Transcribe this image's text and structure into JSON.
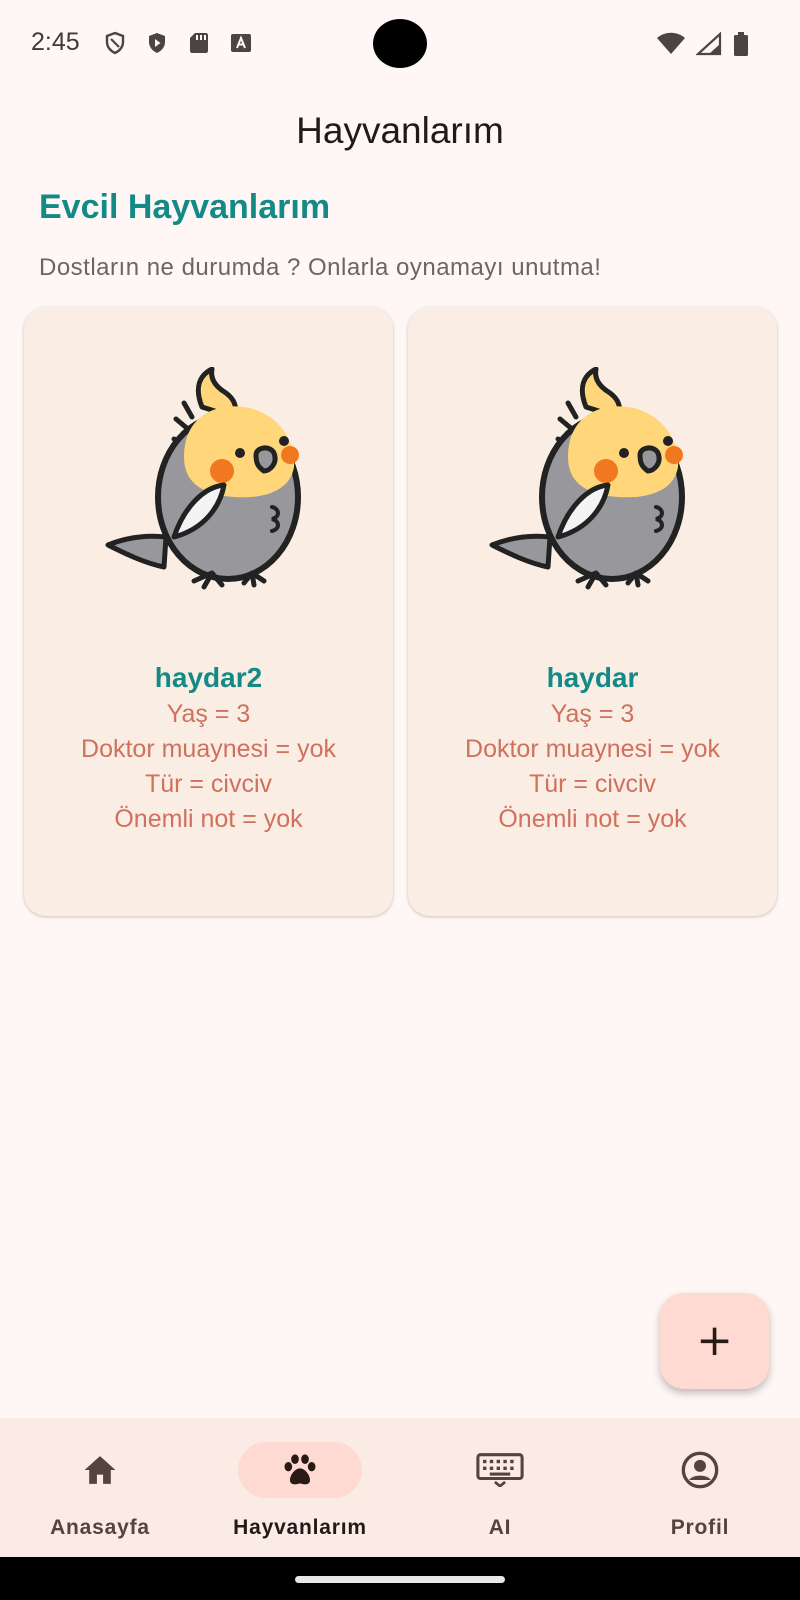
{
  "status_bar": {
    "time": "2:45",
    "icons_left": [
      "shield-outline-icon",
      "play-shield-icon",
      "sd-card-icon",
      "text-a-icon"
    ],
    "icons_right": [
      "wifi-icon",
      "cellular-signal-icon",
      "battery-icon"
    ]
  },
  "app_bar": {
    "title": "Hayvanlarım"
  },
  "section": {
    "title": "Evcil Hayvanlarım",
    "subtitle": "Dostların ne durumda ? Onlarla oynamayı unutma!"
  },
  "pets": [
    {
      "name": "haydar2",
      "age_line": "Yaş = 3",
      "doctor_line": "Doktor muaynesi = yok",
      "type_line": "Tür = civciv",
      "note_line": "Önemli not = yok",
      "image": "cockatiel-illustration"
    },
    {
      "name": "haydar",
      "age_line": "Yaş = 3",
      "doctor_line": "Doktor muaynesi = yok",
      "type_line": "Tür = civciv",
      "note_line": "Önemli not = yok",
      "image": "cockatiel-illustration"
    }
  ],
  "fab": {
    "icon": "plus-icon",
    "symbol": "+"
  },
  "bottom_nav": [
    {
      "label": "Anasayfa",
      "icon": "home-icon",
      "active": false
    },
    {
      "label": "Hayvanlarım",
      "icon": "paw-icon",
      "active": true
    },
    {
      "label": "AI",
      "icon": "keyboard-icon",
      "active": false
    },
    {
      "label": "Profil",
      "icon": "account-circle-icon",
      "active": false
    }
  ],
  "colors": {
    "background": "#fff7f5",
    "accent_teal": "#138a86",
    "card_text": "#d0705d",
    "card_bg": "#faeee4",
    "fab_bg": "#ffdad2",
    "nav_bg": "#fbebe5"
  }
}
